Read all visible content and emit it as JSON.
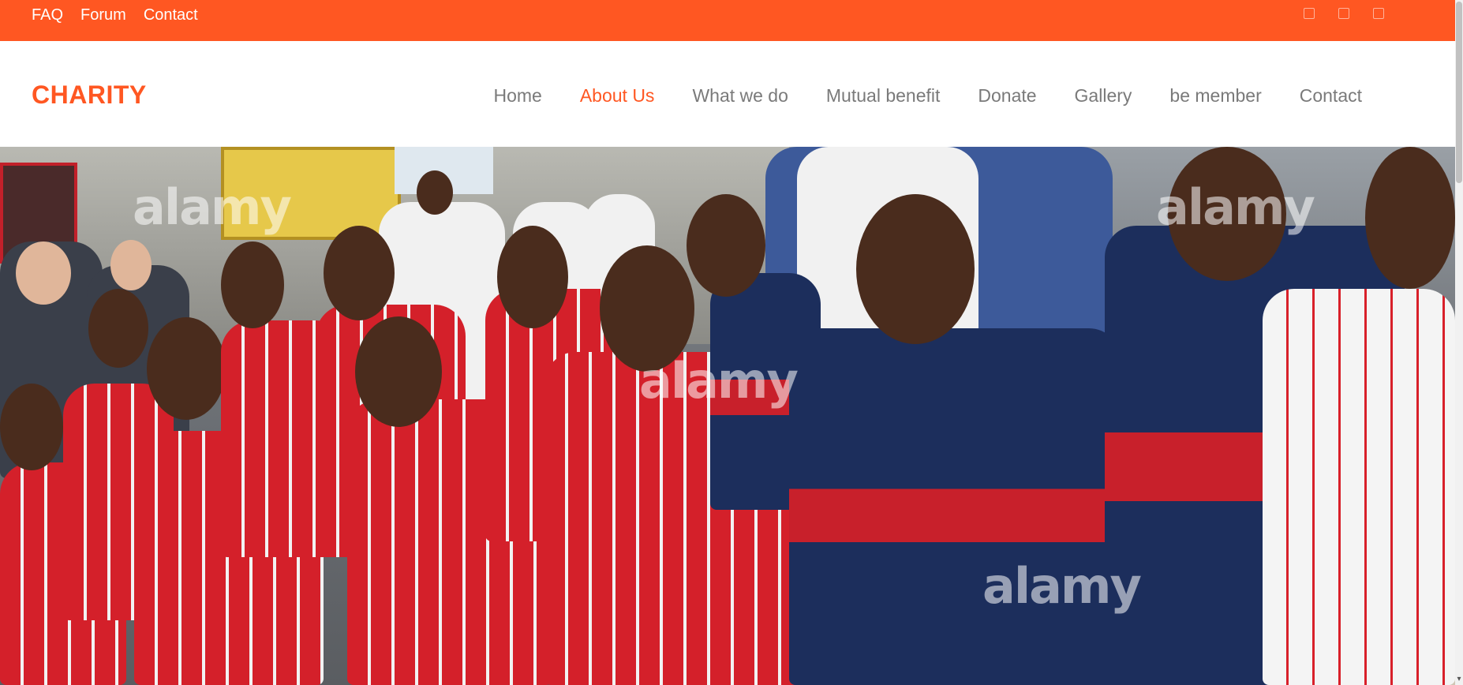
{
  "topbar": {
    "links": [
      {
        "label": "FAQ"
      },
      {
        "label": "Forum"
      },
      {
        "label": "Contact"
      }
    ],
    "social_icons": [
      "facebook-icon",
      "twitter-icon",
      "instagram-icon"
    ]
  },
  "header": {
    "logo": "CHARITY",
    "nav": [
      {
        "label": "Home",
        "active": false
      },
      {
        "label": "About Us",
        "active": true
      },
      {
        "label": "What we do",
        "active": false
      },
      {
        "label": "Mutual benefit",
        "active": false
      },
      {
        "label": "Donate",
        "active": false
      },
      {
        "label": "Gallery",
        "active": false
      },
      {
        "label": "be member",
        "active": false
      },
      {
        "label": "Contact",
        "active": false
      }
    ]
  },
  "hero": {
    "watermark": "alamy"
  },
  "colors": {
    "accent": "#ff5722",
    "nav_text": "#7a7a7a",
    "background": "#ffffff"
  }
}
